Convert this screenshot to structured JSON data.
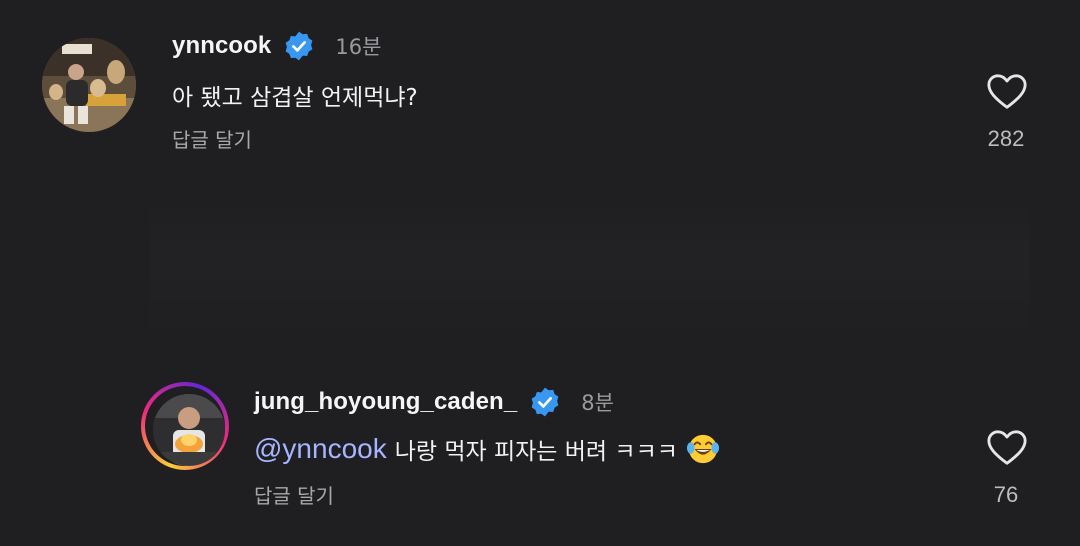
{
  "comments": [
    {
      "username": "ynncook",
      "verified": true,
      "time": "16분",
      "text": "아 됐고 삼겹살 언제먹냐?",
      "reply_label": "답글 달기",
      "likes": "282"
    },
    {
      "username": "jung_hoyoung_caden_",
      "verified": true,
      "time": "8분",
      "mention": "@ynncook",
      "text": "나랑 먹자 피자는 버려 ㅋㅋㅋ",
      "emoji": "face-with-tears-of-joy",
      "reply_label": "답글 달기",
      "likes": "76"
    }
  ],
  "colors": {
    "background": "#1f1f22",
    "verified_badge": "#3897f0",
    "mention": "#a7b4ff",
    "secondary_text": "#9a9a9e"
  }
}
